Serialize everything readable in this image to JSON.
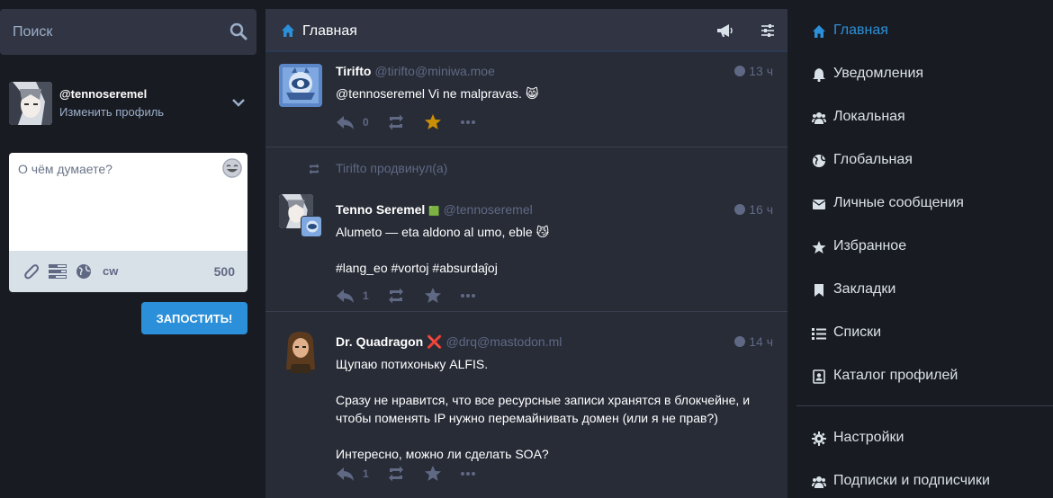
{
  "search": {
    "placeholder": "Поиск"
  },
  "account": {
    "handle": "@tennoseremel",
    "edit_profile": "Изменить профиль"
  },
  "compose": {
    "placeholder": "О чём думаете?",
    "cw_label": "cw",
    "char_count": "500",
    "publish_label": "ЗАПОСТИТЬ!"
  },
  "column": {
    "title": "Главная"
  },
  "statuses": [
    {
      "display_name": "Tirifto",
      "acct": "@tirifto@miniwa.moe",
      "time": "13 ч",
      "content": [
        "@tennoseremel Vi ne malpravas. 😸"
      ],
      "replies": "0"
    },
    {
      "boosted_by": "Tirifto продвинул(а)",
      "display_name": "Tenno Seremel",
      "flag": "🟩",
      "acct": "@tennoseremel",
      "time": "16 ч",
      "content": [
        "Alumeto — eta aldono al umo, eble 😼",
        "#lang_eo #vortoj #absurdaĵoj"
      ],
      "replies": "1"
    },
    {
      "display_name": "Dr. Quadragon",
      "badge": "❌",
      "acct": "@drq@mastodon.ml",
      "time": "14 ч",
      "content": [
        "Щупаю потихоньку ALFIS.",
        "Сразу не нравится, что все ресурсные записи хранятся в блокчейне, и чтобы поменять IP нужно перемайнивать домен (или я не прав?)",
        "Интересно, можно ли сделать SOA?"
      ],
      "replies": "1"
    }
  ],
  "nav": {
    "items": [
      {
        "label": "Главная",
        "icon": "home-icon"
      },
      {
        "label": "Уведомления",
        "icon": "bell-icon"
      },
      {
        "label": "Локальная",
        "icon": "users-icon"
      },
      {
        "label": "Глобальная",
        "icon": "globe-icon"
      },
      {
        "label": "Личные сообщения",
        "icon": "envelope-icon"
      },
      {
        "label": "Избранное",
        "icon": "star-icon"
      },
      {
        "label": "Закладки",
        "icon": "bookmark-icon"
      },
      {
        "label": "Списки",
        "icon": "list-icon"
      },
      {
        "label": "Каталог профилей",
        "icon": "address-book-icon"
      },
      {
        "label": "Настройки",
        "icon": "gear-icon"
      },
      {
        "label": "Подписки и подписчики",
        "icon": "users-icon"
      }
    ]
  },
  "colors": {
    "accent": "#2b90d9",
    "favourited": "#ca8f04",
    "background": "#191b22",
    "column": "#282c37"
  }
}
